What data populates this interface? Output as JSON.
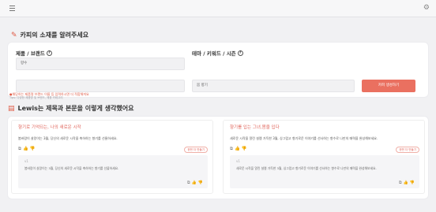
{
  "section1": {
    "title": "카피의 소재를 알려주세요",
    "product_label": "제품 / 브랜드",
    "product_value": "향수",
    "theme_label": "테마 / 키워드 / 시즌",
    "theme_value": "봄 향기",
    "warning": "●해당하는 제품명 브랜드 이름 등 입력하시면 더 적합해져요",
    "warning_sub": "Tips: 다양한 제품명 및 브랜드, 제품 카테고리",
    "generate_button": "카피 생성하기"
  },
  "section2": {
    "title": "Lewis는 제목과 본문을 이렇게 생각했어요",
    "cards": [
      {
        "title": "향기로 기억되는, 나의 새로운 시작",
        "body": "봄바람이 살랑이는 3월, 당신의 새로운 시작을 축하하는 향기를 선물하세요.",
        "badge": "한번 더 만들기",
        "sub_label": "v1",
        "sub_body": "봄바람이 살랑이는 3월, 당신의 새로운 시작을 축하하는 향기를 선물하세요."
      },
      {
        "title": "향기를 입는 그녀,봄을 입다",
        "body": "새로운 시작을 알린 설렘 가득한 3월, 싱그럽고 향기로운 이야기를 선사하는 향수로 나만의 매력을 완성해보세요.",
        "badge": "한번 더 만들기",
        "sub_label": "v1",
        "sub_body": "새로운 시작을 알린 설렘 가득한 3월, 싱그럽고 향기로운 이야기를 선사하는 향수로 나만의 매력을 완성해보세요."
      }
    ]
  },
  "icons": {
    "menu": "menu-icon",
    "settings": "gear-icon",
    "copy": "copy-icon",
    "like": "thumbs-up-icon",
    "dislike": "thumbs-down-icon"
  },
  "colors": {
    "accent": "#ea7060",
    "title_accent": "#e0645a"
  }
}
